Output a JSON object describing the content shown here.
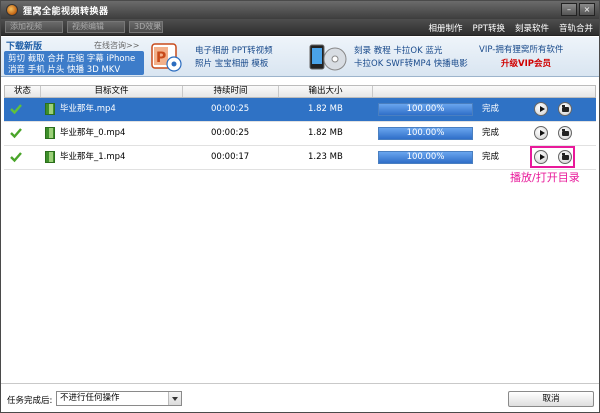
{
  "window": {
    "title": "狸窝全能视频转换器"
  },
  "toolbar": {
    "buttons": [
      "添加视频",
      "视频编辑",
      "3D效果"
    ],
    "links": [
      "相册制作",
      "PPT转换",
      "刻录软件",
      "音轨合并"
    ]
  },
  "banner": {
    "title": "下载新版",
    "more": "在线咨询>>",
    "feature_line1": "剪切 截取 合并 压缩 字幕 iPhone",
    "feature_line2": "消音 手机 片头 快播 3D MKV",
    "ppt_line1": "电子相册 PPT转视频",
    "ppt_line2": "照片 宝宝相册 模板",
    "burn_line1": "刻录 教程 卡拉OK 蓝光",
    "burn_line2": "卡拉OK SWF转MP4 快播电影",
    "vip_title": "VIP-拥有狸窝所有软件",
    "vip_sub": "升级VIP会员"
  },
  "table": {
    "columns": [
      "状态",
      "目标文件",
      "持续时间",
      "输出大小",
      ""
    ],
    "rows": [
      {
        "file": "毕业那年.mp4",
        "duration": "00:00:25",
        "size": "1.82 MB",
        "progress": "100.00%",
        "status": "完成"
      },
      {
        "file": "毕业那年_0.mp4",
        "duration": "00:00:25",
        "size": "1.82 MB",
        "progress": "100.00%",
        "status": "完成"
      },
      {
        "file": "毕业那年_1.mp4",
        "duration": "00:00:17",
        "size": "1.23 MB",
        "progress": "100.00%",
        "status": "完成"
      }
    ]
  },
  "annotation": {
    "text": "播放/打开目录"
  },
  "bottom": {
    "label": "任务完成后:",
    "select_value": "不进行任何操作",
    "cancel": "取消"
  },
  "colors": {
    "selected_row": "#2f72c5",
    "annotation": "#e8199a",
    "vip": "#d00000"
  }
}
